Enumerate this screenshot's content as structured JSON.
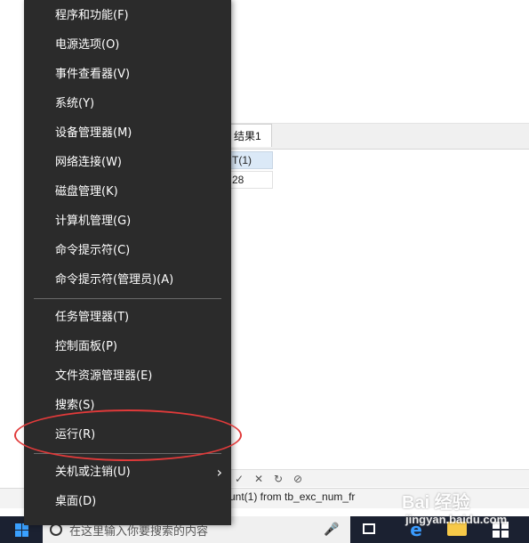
{
  "menu": {
    "group1": [
      {
        "label": "程序和功能(F)"
      },
      {
        "label": "电源选项(O)"
      },
      {
        "label": "事件查看器(V)"
      },
      {
        "label": "系统(Y)"
      },
      {
        "label": "设备管理器(M)"
      },
      {
        "label": "网络连接(W)"
      },
      {
        "label": "磁盘管理(K)"
      },
      {
        "label": "计算机管理(G)"
      },
      {
        "label": "命令提示符(C)"
      },
      {
        "label": "命令提示符(管理员)(A)"
      }
    ],
    "group2": [
      {
        "label": "任务管理器(T)"
      },
      {
        "label": "控制面板(P)"
      },
      {
        "label": "文件资源管理器(E)"
      },
      {
        "label": "搜索(S)"
      },
      {
        "label": "运行(R)"
      }
    ],
    "group3": [
      {
        "label": "关机或注销(U)",
        "submenu_arrow": "›"
      },
      {
        "label": "桌面(D)"
      }
    ],
    "highlighted_item": "运行(R)",
    "highlight_color": "#e03a3a"
  },
  "background_app": {
    "result_tab": "结果1",
    "grid_header": "T(1)",
    "grid_value": "28",
    "toolbar_icons": [
      "✓",
      "✕",
      "↻",
      "⊘"
    ],
    "sql_text": "unt(1) from tb_exc_num_fr"
  },
  "taskbar": {
    "search_placeholder": "在这里输入你要搜索的内容",
    "icons": [
      "windows-logo-icon",
      "search-circle-icon",
      "microphone-icon",
      "task-view-icon",
      "edge-icon",
      "file-explorer-icon",
      "store-icon"
    ]
  },
  "watermark": {
    "main": "Bai 经验",
    "sub": "jingyan.baidu.com"
  },
  "colors": {
    "menu_bg": "#2b2b2b",
    "taskbar_bg": "#1b2131",
    "accent": "#3aa0ff"
  }
}
